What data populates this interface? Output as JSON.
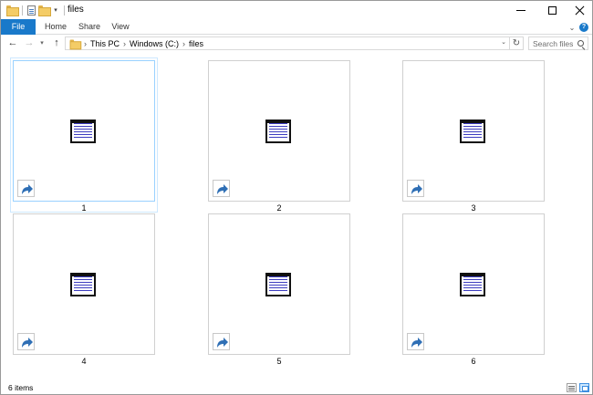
{
  "window": {
    "title": "files"
  },
  "ribbon": {
    "tabs": [
      {
        "label": "File",
        "active": true
      },
      {
        "label": "Home",
        "active": false
      },
      {
        "label": "Share",
        "active": false
      },
      {
        "label": "View",
        "active": false
      }
    ],
    "accent": "#1979ca"
  },
  "address": {
    "breadcrumbs": [
      "This PC",
      "Windows (C:)",
      "files"
    ]
  },
  "search": {
    "placeholder": "Search files"
  },
  "files": [
    {
      "name": "1",
      "icon": "text-document-icon",
      "shortcut": true,
      "selected": true
    },
    {
      "name": "2",
      "icon": "text-document-icon",
      "shortcut": true,
      "selected": false
    },
    {
      "name": "3",
      "icon": "text-document-icon",
      "shortcut": true,
      "selected": false
    },
    {
      "name": "4",
      "icon": "text-document-icon",
      "shortcut": true,
      "selected": false
    },
    {
      "name": "5",
      "icon": "text-document-icon",
      "shortcut": true,
      "selected": false
    },
    {
      "name": "6",
      "icon": "text-document-icon",
      "shortcut": true,
      "selected": false
    }
  ],
  "status": {
    "item_count": "6 items"
  }
}
